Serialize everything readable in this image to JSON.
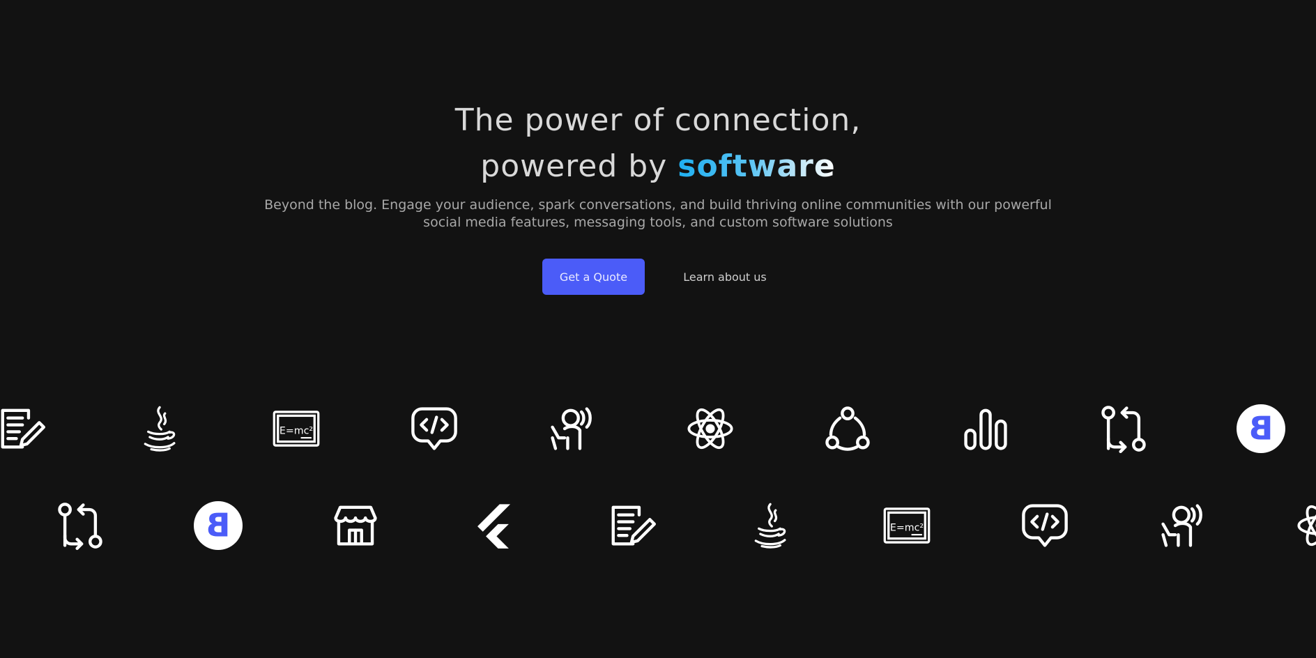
{
  "hero": {
    "headline_line1": "The power of connection,",
    "headline_line2_prefix": "powered by ",
    "headline_accent": "software",
    "subtitle_line1": "Beyond the blog. Engage your audience, spark conversations, and build thriving online communities with our powerful",
    "subtitle_line2": "social media features, messaging tools, and custom software solutions"
  },
  "actions": {
    "primary_label": "Get a Quote",
    "secondary_label": "Learn about us"
  },
  "colors": {
    "background": "#121212",
    "primary_button": "#4b5cf8",
    "accent_gradient_start": "#1fb0f2",
    "accent_gradient_end": "#ffffff",
    "icon": "#ffffff",
    "badge_letter": "#4b5cf8"
  },
  "tech_strip": {
    "row1": [
      "blog-edit-icon",
      "java-icon",
      "chalkboard-formula-icon",
      "code-chat-icon",
      "voice-user-icon",
      "react-icon",
      "community-cycle-icon",
      "bar-chart-icon",
      "pull-request-icon",
      "bootstrap-icon"
    ],
    "row2": [
      "pull-request-icon",
      "bootstrap-icon",
      "store-icon",
      "flutter-icon",
      "blog-edit-icon",
      "java-icon",
      "chalkboard-formula-icon",
      "code-chat-icon",
      "voice-user-icon",
      "react-icon"
    ]
  }
}
